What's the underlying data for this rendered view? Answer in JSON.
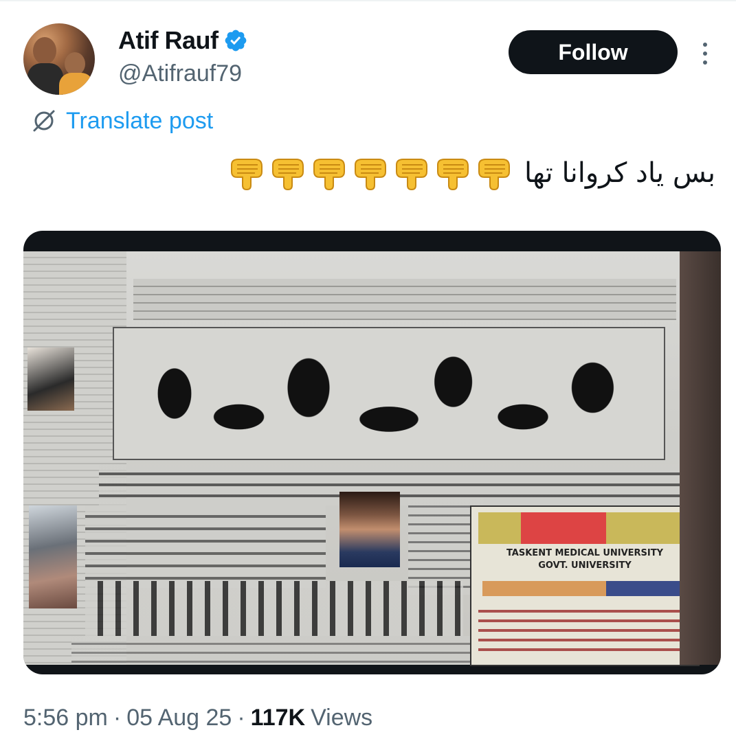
{
  "author": {
    "display_name": "Atif Rauf",
    "handle": "@Atifrauf79",
    "verified": true
  },
  "follow_label": "Follow",
  "translate_label": "Translate post",
  "post": {
    "text_urdu": "بس یاد کروانا تھا",
    "emoji_name": "backhand-index-pointing-down",
    "emoji_count": 7
  },
  "meta": {
    "time": "5:56 pm",
    "date": "05 Aug 25",
    "views_count": "117K",
    "views_label": "Views",
    "separator": "·"
  },
  "media": {
    "ad_line1": "TASKENT MEDICAL UNIVERSITY",
    "ad_line2": "GOVT. UNIVERSITY"
  },
  "colors": {
    "accent": "#1d9bf0",
    "text": "#0f1419",
    "secondary": "#536471",
    "button_bg": "#0f1419"
  }
}
